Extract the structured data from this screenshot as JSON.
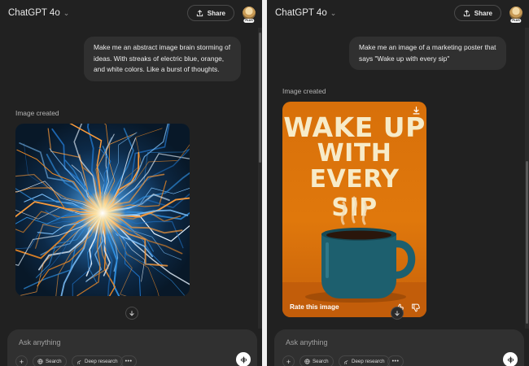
{
  "left": {
    "model_name": "ChatGPT 4o",
    "share_label": "Share",
    "plan_badge": "PLUS",
    "prompt": "Make me an abstract image brain storming of ideas. With streaks of electric blue, orange, and white colors. Like a burst of thoughts.",
    "image_status": "Image created",
    "composer": {
      "placeholder": "Ask anything",
      "search_label": "Search",
      "deep_research_label": "Deep research",
      "more_label": "•••"
    }
  },
  "right": {
    "model_name": "ChatGPT 4o",
    "share_label": "Share",
    "plan_badge": "PLUS",
    "prompt": "Make me an image of a marketing poster that says \"Wake up with every sip\"",
    "image_status": "Image created",
    "poster_lines": [
      "WAKE UP",
      "WITH",
      "EVERY SIP"
    ],
    "rate_label": "Rate this image",
    "composer": {
      "placeholder": "Ask anything",
      "search_label": "Search",
      "deep_research_label": "Deep research",
      "more_label": "•••"
    }
  },
  "colors": {
    "background": "#212121",
    "bubble": "#303030",
    "poster_orange": "#e0780c",
    "poster_text": "#f7ebc8",
    "mug_teal": "#1d5f6e"
  },
  "icons": [
    "chevron-down-icon",
    "share-icon",
    "download-icon",
    "thumbs-up-icon",
    "thumbs-down-icon",
    "arrow-down-icon",
    "plus-icon",
    "globe-icon",
    "telescope-icon",
    "voice-icon"
  ]
}
